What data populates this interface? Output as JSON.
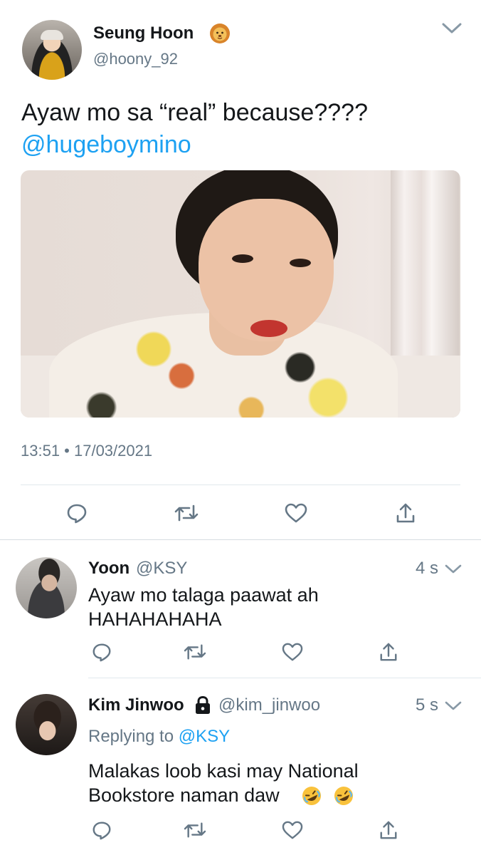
{
  "main_tweet": {
    "author_name": "Seung Hoon",
    "author_emoji": "lion-face-emoji",
    "author_handle": "@hoony_92",
    "text": "Ayaw mo sa “real” because????",
    "mention": "@hugeboymino",
    "timestamp": "13:51 • 17/03/2021",
    "actions": [
      "reply-icon",
      "retweet-icon",
      "like-icon",
      "share-icon"
    ]
  },
  "replies": [
    {
      "author_name": "Yoon",
      "author_handle": "@KSY",
      "time": "4 s",
      "text_line1": "Ayaw mo talaga paawat ah",
      "text_line2": "HAHAHAHAHA"
    },
    {
      "author_name": "Kim Jinwoo",
      "locked": true,
      "author_handle": "@kim_jinwoo",
      "time": "5 s",
      "replying_prefix": "Replying to",
      "replying_to": "@KSY",
      "text_line1": "Malakas loob kasi may National",
      "text_line2": "Bookstore naman daw",
      "text_emojis": [
        "rolling-on-floor-laughing-emoji",
        "rolling-on-floor-laughing-emoji"
      ]
    }
  ],
  "colors": {
    "text": "#14171a",
    "secondary": "#657786",
    "link": "#1da1f2",
    "divider": "#e1e8ed"
  }
}
